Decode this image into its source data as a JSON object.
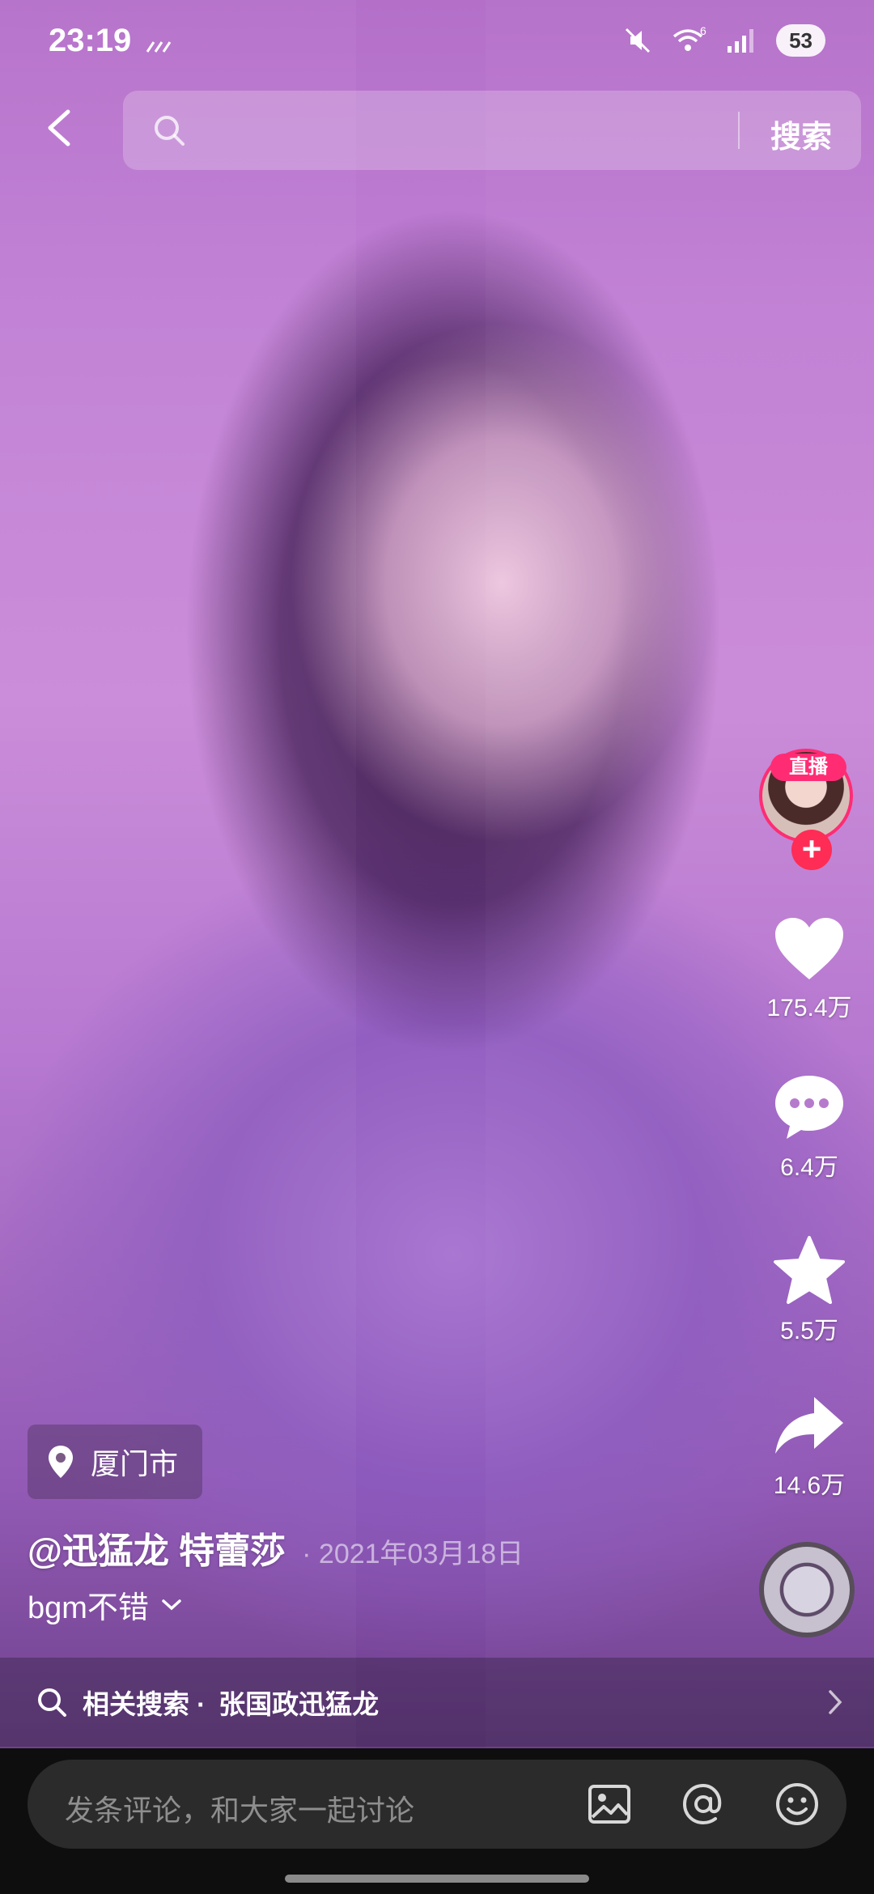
{
  "status_bar": {
    "time": "23:19",
    "network_label": "6",
    "battery": "53"
  },
  "top_bar": {
    "search_placeholder": "",
    "search_button": "搜索"
  },
  "actions": {
    "live_badge": "直播",
    "follow_plus": "+",
    "likes": "175.4万",
    "comments": "6.4万",
    "favorites": "5.5万",
    "shares": "14.6万"
  },
  "video_info": {
    "location": "厦门市",
    "author": "@迅猛龙 特蕾莎",
    "date": "· 2021年03月18日",
    "caption": "bgm不错"
  },
  "related_search": {
    "label": "相关搜索 ·",
    "term": "张国政迅猛龙"
  },
  "comment_bar": {
    "placeholder": "发条评论，和大家一起讨论"
  },
  "colors": {
    "accent_pink": "#ff2c74",
    "comment_bg": "#2b2b2b"
  }
}
